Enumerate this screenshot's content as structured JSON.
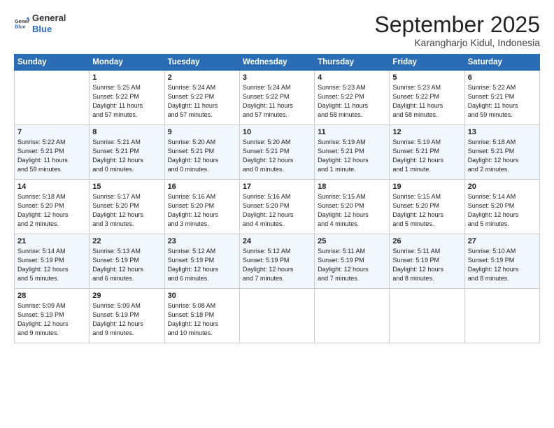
{
  "header": {
    "logo_line1": "General",
    "logo_line2": "Blue",
    "month_title": "September 2025",
    "location": "Karangharjo Kidul, Indonesia"
  },
  "days_of_week": [
    "Sunday",
    "Monday",
    "Tuesday",
    "Wednesday",
    "Thursday",
    "Friday",
    "Saturday"
  ],
  "weeks": [
    [
      {
        "day": "",
        "info": ""
      },
      {
        "day": "1",
        "info": "Sunrise: 5:25 AM\nSunset: 5:22 PM\nDaylight: 11 hours\nand 57 minutes."
      },
      {
        "day": "2",
        "info": "Sunrise: 5:24 AM\nSunset: 5:22 PM\nDaylight: 11 hours\nand 57 minutes."
      },
      {
        "day": "3",
        "info": "Sunrise: 5:24 AM\nSunset: 5:22 PM\nDaylight: 11 hours\nand 57 minutes."
      },
      {
        "day": "4",
        "info": "Sunrise: 5:23 AM\nSunset: 5:22 PM\nDaylight: 11 hours\nand 58 minutes."
      },
      {
        "day": "5",
        "info": "Sunrise: 5:23 AM\nSunset: 5:22 PM\nDaylight: 11 hours\nand 58 minutes."
      },
      {
        "day": "6",
        "info": "Sunrise: 5:22 AM\nSunset: 5:21 PM\nDaylight: 11 hours\nand 59 minutes."
      }
    ],
    [
      {
        "day": "7",
        "info": "Sunrise: 5:22 AM\nSunset: 5:21 PM\nDaylight: 11 hours\nand 59 minutes."
      },
      {
        "day": "8",
        "info": "Sunrise: 5:21 AM\nSunset: 5:21 PM\nDaylight: 12 hours\nand 0 minutes."
      },
      {
        "day": "9",
        "info": "Sunrise: 5:20 AM\nSunset: 5:21 PM\nDaylight: 12 hours\nand 0 minutes."
      },
      {
        "day": "10",
        "info": "Sunrise: 5:20 AM\nSunset: 5:21 PM\nDaylight: 12 hours\nand 0 minutes."
      },
      {
        "day": "11",
        "info": "Sunrise: 5:19 AM\nSunset: 5:21 PM\nDaylight: 12 hours\nand 1 minute."
      },
      {
        "day": "12",
        "info": "Sunrise: 5:19 AM\nSunset: 5:21 PM\nDaylight: 12 hours\nand 1 minute."
      },
      {
        "day": "13",
        "info": "Sunrise: 5:18 AM\nSunset: 5:21 PM\nDaylight: 12 hours\nand 2 minutes."
      }
    ],
    [
      {
        "day": "14",
        "info": "Sunrise: 5:18 AM\nSunset: 5:20 PM\nDaylight: 12 hours\nand 2 minutes."
      },
      {
        "day": "15",
        "info": "Sunrise: 5:17 AM\nSunset: 5:20 PM\nDaylight: 12 hours\nand 3 minutes."
      },
      {
        "day": "16",
        "info": "Sunrise: 5:16 AM\nSunset: 5:20 PM\nDaylight: 12 hours\nand 3 minutes."
      },
      {
        "day": "17",
        "info": "Sunrise: 5:16 AM\nSunset: 5:20 PM\nDaylight: 12 hours\nand 4 minutes."
      },
      {
        "day": "18",
        "info": "Sunrise: 5:15 AM\nSunset: 5:20 PM\nDaylight: 12 hours\nand 4 minutes."
      },
      {
        "day": "19",
        "info": "Sunrise: 5:15 AM\nSunset: 5:20 PM\nDaylight: 12 hours\nand 5 minutes."
      },
      {
        "day": "20",
        "info": "Sunrise: 5:14 AM\nSunset: 5:20 PM\nDaylight: 12 hours\nand 5 minutes."
      }
    ],
    [
      {
        "day": "21",
        "info": "Sunrise: 5:14 AM\nSunset: 5:19 PM\nDaylight: 12 hours\nand 5 minutes."
      },
      {
        "day": "22",
        "info": "Sunrise: 5:13 AM\nSunset: 5:19 PM\nDaylight: 12 hours\nand 6 minutes."
      },
      {
        "day": "23",
        "info": "Sunrise: 5:12 AM\nSunset: 5:19 PM\nDaylight: 12 hours\nand 6 minutes."
      },
      {
        "day": "24",
        "info": "Sunrise: 5:12 AM\nSunset: 5:19 PM\nDaylight: 12 hours\nand 7 minutes."
      },
      {
        "day": "25",
        "info": "Sunrise: 5:11 AM\nSunset: 5:19 PM\nDaylight: 12 hours\nand 7 minutes."
      },
      {
        "day": "26",
        "info": "Sunrise: 5:11 AM\nSunset: 5:19 PM\nDaylight: 12 hours\nand 8 minutes."
      },
      {
        "day": "27",
        "info": "Sunrise: 5:10 AM\nSunset: 5:19 PM\nDaylight: 12 hours\nand 8 minutes."
      }
    ],
    [
      {
        "day": "28",
        "info": "Sunrise: 5:09 AM\nSunset: 5:19 PM\nDaylight: 12 hours\nand 9 minutes."
      },
      {
        "day": "29",
        "info": "Sunrise: 5:09 AM\nSunset: 5:19 PM\nDaylight: 12 hours\nand 9 minutes."
      },
      {
        "day": "30",
        "info": "Sunrise: 5:08 AM\nSunset: 5:18 PM\nDaylight: 12 hours\nand 10 minutes."
      },
      {
        "day": "",
        "info": ""
      },
      {
        "day": "",
        "info": ""
      },
      {
        "day": "",
        "info": ""
      },
      {
        "day": "",
        "info": ""
      }
    ]
  ]
}
